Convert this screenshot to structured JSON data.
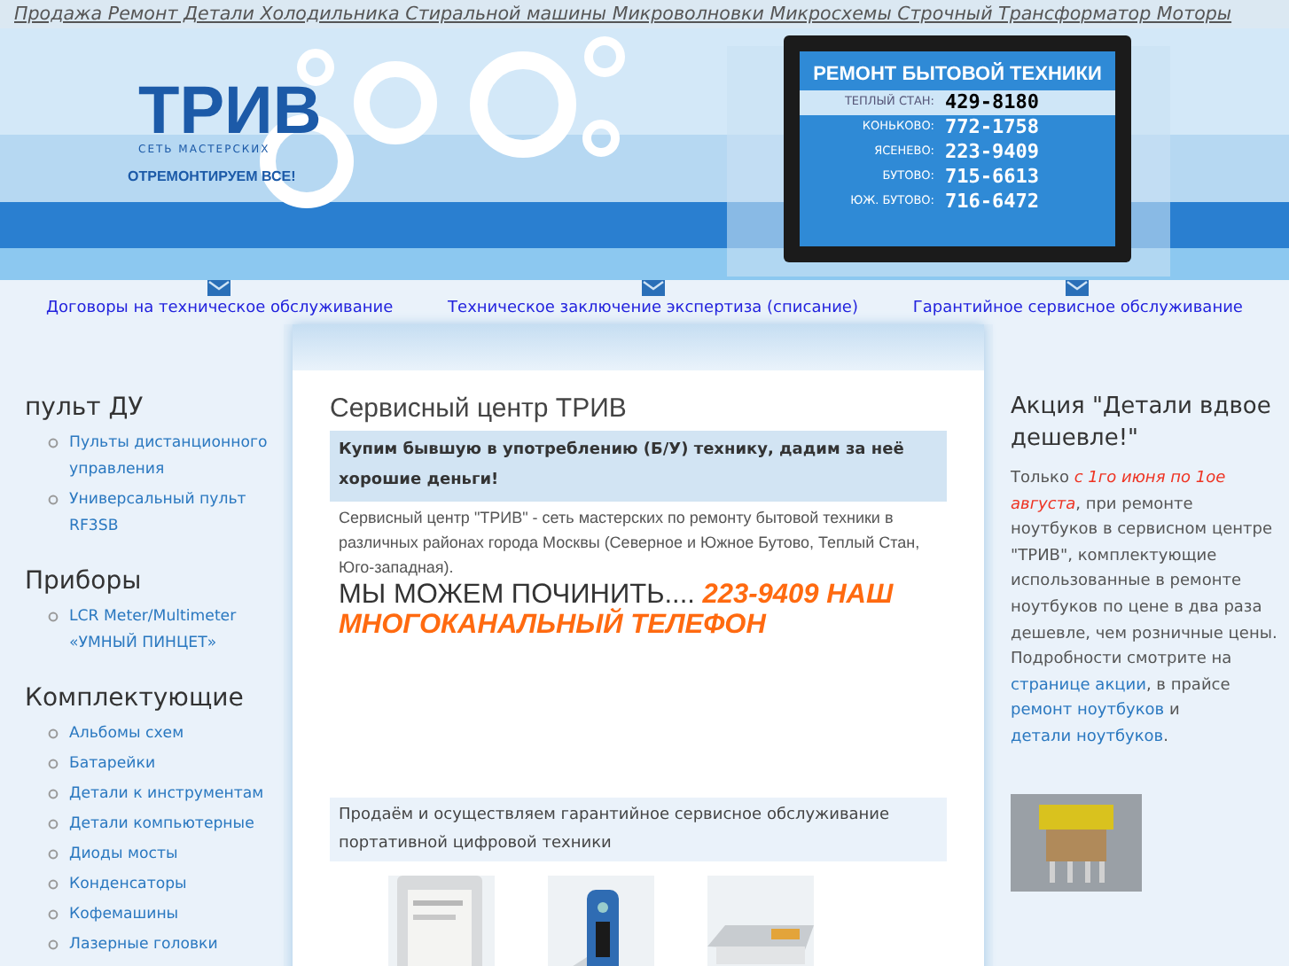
{
  "top_bar": {
    "text": "Продажа Ремонт Детали Холодильника Стиральной машины Микроволновки Микросхемы Строчный Трансформатор Моторы"
  },
  "banner": {
    "logo": {
      "name": "ТРИВ",
      "tagline": "СЕТЬ МАСТЕРСКИХ",
      "slogan": "ОТРЕМОНТИРУЕМ ВСЕ!"
    },
    "tv": {
      "title": "РЕМОНТ БЫТОВОЙ ТЕХНИКИ",
      "rows": [
        {
          "area": "ТЕПЛЫЙ СТАН:",
          "phone": "429-8180",
          "highlighted": true
        },
        {
          "area": "КОНЬКОВО:",
          "phone": "772-1758",
          "highlighted": false
        },
        {
          "area": "ЯСЕНЕВО:",
          "phone": "223-9409",
          "highlighted": false
        },
        {
          "area": "БУТОВО:",
          "phone": "715-6613",
          "highlighted": false
        },
        {
          "area": "ЮЖ. БУТОВО:",
          "phone": "716-6472",
          "highlighted": false
        }
      ]
    }
  },
  "nav": [
    "Договоры на техническое обслуживание",
    "Техническое заключение экспертиза (списание)",
    "Гарантийное сервисное обслуживание"
  ],
  "left_sidebar": [
    {
      "title": "пульт ДУ",
      "items": [
        "Пульты дистанционного управления",
        "Универсальный пульт RF3SB"
      ]
    },
    {
      "title": "Приборы",
      "items": [
        "LCR Meter/Multimeter «УМНЫЙ ПИНЦЕТ»"
      ]
    },
    {
      "title": "Комплектующие",
      "items": [
        "Альбомы схем",
        "Батарейки",
        "Детали к инструментам",
        "Детали компьютерные",
        "Диоды мосты",
        "Конденсаторы",
        "Кофемашины",
        "Лазерные головки"
      ]
    }
  ],
  "main": {
    "title": "Сервисный центр ТРИВ",
    "notice": "Купим бывшую в употреблению (Б/У) технику, дадим за неё хорошие деньги!",
    "description": "Сервисный центр \"ТРИВ\" - сеть мастерских по ремонту бытовой техники в различных районах города Москвы (Северное и Южное Бутово, Теплый Стан, Юго-западная).",
    "headline": {
      "plain": "МЫ МОЖЕМ ПОЧИНИТЬ.... ",
      "highlight": "223-9409 НАШ МНОГОКАНАЛЬНЫЙ ТЕЛЕФОН"
    },
    "promo": " Продаём и осуществляем гарантийное сервисное обслуживание портативной цифровой техники"
  },
  "right_sidebar": {
    "title": "Акция \"Детали вдвое дешевле!\"",
    "paragraph": [
      {
        "kind": "plain",
        "text": "Только "
      },
      {
        "kind": "highlight",
        "text": "с 1го июня по 1ое августа"
      },
      {
        "kind": "plain",
        "text": ", при ремонте ноутбуков в сервисном центре \"ТРИВ\", комплектующие использованные в ремонте ноутбуков по цене в два раза дешевле, чем розничные цены. Подробности смотрите на "
      },
      {
        "kind": "link",
        "text": "странице акции"
      },
      {
        "kind": "plain",
        "text": ", в прайсе "
      },
      {
        "kind": "link",
        "text": "ремонт ноутбуков"
      },
      {
        "kind": "plain",
        "text": " и "
      },
      {
        "kind": "link",
        "text": "детали ноутбуков"
      },
      {
        "kind": "plain",
        "text": "."
      }
    ]
  }
}
